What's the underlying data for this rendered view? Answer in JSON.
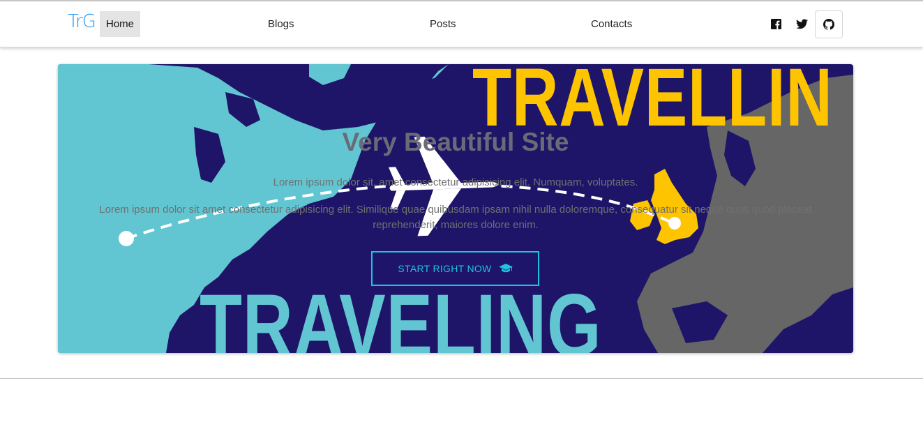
{
  "nav": {
    "brand": "TrG",
    "items": [
      "Home",
      "Blogs",
      "Posts",
      "Contacts"
    ],
    "social": [
      "facebook-icon",
      "twitter-icon",
      "github-icon"
    ]
  },
  "hero": {
    "background_word_top": "TRAVELLIN",
    "background_word_bottom": "TRAVELING",
    "title": "Very Beautiful Site",
    "line1": "Lorem ipsum dolor sit, amet consectetur adipisicing elit. Numquam, voluptates.",
    "line2": "Lorem ipsum dolor sit amet consectetur adipisicing elit. Similique quae quibusdam ipsam nihil nulla doloremque, consequatur sit neque quos quod placeat reprehenderit, maiores dolore enim.",
    "cta_label": "START RIGHT NOW",
    "cta_icon": "graduation-cap-icon"
  },
  "colors": {
    "brand": "#2196f3",
    "ocean": "#1e1569",
    "land_light": "#62c6d2",
    "land_grey": "#666666",
    "accent_yellow": "#ffc400",
    "cta": "#1ec3e0"
  }
}
